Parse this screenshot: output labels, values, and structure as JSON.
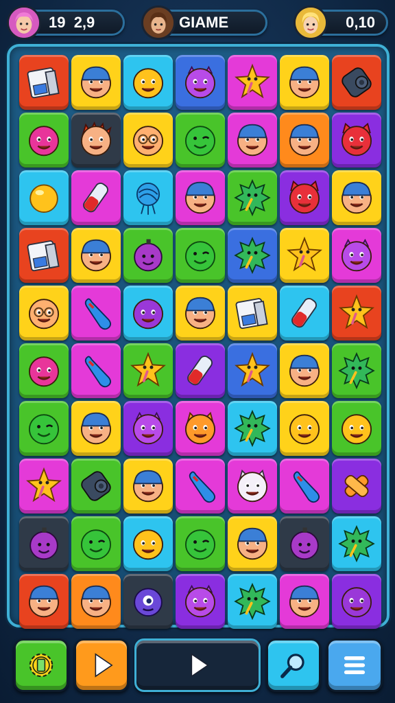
{
  "hud": {
    "left_value": "19  2,9",
    "center_name": "GIAME",
    "right_value": "0,10"
  },
  "colors": {
    "red": "#e8431f",
    "yellow": "#ffd21a",
    "cyan": "#2ec4ef",
    "blue": "#3a6fe0",
    "magenta": "#e43ad8",
    "purple": "#8a2ee0",
    "green": "#49c42a",
    "dark": "#2f3a48",
    "orange": "#ff8a1c"
  },
  "board": {
    "rows": [
      [
        {
          "bg": "red",
          "icon": "floppy-disk-icon"
        },
        {
          "bg": "yellow",
          "icon": "beanie-face-icon"
        },
        {
          "bg": "cyan",
          "icon": "smiley-face-icon"
        },
        {
          "bg": "blue",
          "icon": "purple-devil-icon"
        },
        {
          "bg": "magenta",
          "icon": "star-creature-icon"
        },
        {
          "bg": "yellow",
          "icon": "beanie-face-icon"
        },
        {
          "bg": "red",
          "icon": "film-roll-icon"
        }
      ],
      [
        {
          "bg": "green",
          "icon": "magenta-smiley-icon"
        },
        {
          "bg": "dark",
          "icon": "spiky-hair-face-icon"
        },
        {
          "bg": "yellow",
          "icon": "glasses-face-icon"
        },
        {
          "bg": "green",
          "icon": "green-wink-icon"
        },
        {
          "bg": "magenta",
          "icon": "beanie-face-icon"
        },
        {
          "bg": "orange",
          "icon": "beanie-face-icon"
        },
        {
          "bg": "purple",
          "icon": "red-cat-icon"
        }
      ],
      [
        {
          "bg": "cyan",
          "icon": "yellow-ball-icon"
        },
        {
          "bg": "magenta",
          "icon": "battery-icon"
        },
        {
          "bg": "cyan",
          "icon": "yarn-ball-icon"
        },
        {
          "bg": "magenta",
          "icon": "beanie-face-icon"
        },
        {
          "bg": "green",
          "icon": "spiky-creature-icon"
        },
        {
          "bg": "purple",
          "icon": "red-cat-icon"
        },
        {
          "bg": "yellow",
          "icon": "beanie-face-icon"
        }
      ],
      [
        {
          "bg": "red",
          "icon": "floppy-disk-icon"
        },
        {
          "bg": "yellow",
          "icon": "beanie-face-icon"
        },
        {
          "bg": "green",
          "icon": "bomb-face-icon"
        },
        {
          "bg": "green",
          "icon": "green-wink-icon"
        },
        {
          "bg": "blue",
          "icon": "spiky-creature-icon"
        },
        {
          "bg": "yellow",
          "icon": "star-creature-icon"
        },
        {
          "bg": "magenta",
          "icon": "purple-devil-icon"
        }
      ],
      [
        {
          "bg": "yellow",
          "icon": "glasses-face-icon"
        },
        {
          "bg": "magenta",
          "icon": "bowling-pin-icon"
        },
        {
          "bg": "cyan",
          "icon": "purple-ball-icon"
        },
        {
          "bg": "yellow",
          "icon": "beanie-face-icon"
        },
        {
          "bg": "yellow",
          "icon": "floppy-disk-icon"
        },
        {
          "bg": "cyan",
          "icon": "battery-icon"
        },
        {
          "bg": "red",
          "icon": "star-creature-icon"
        }
      ],
      [
        {
          "bg": "green",
          "icon": "magenta-smiley-icon"
        },
        {
          "bg": "magenta",
          "icon": "bowling-pin-icon"
        },
        {
          "bg": "green",
          "icon": "star-creature-icon"
        },
        {
          "bg": "purple",
          "icon": "battery-icon"
        },
        {
          "bg": "blue",
          "icon": "star-creature-icon"
        },
        {
          "bg": "yellow",
          "icon": "beanie-face-icon"
        },
        {
          "bg": "green",
          "icon": "spiky-creature-icon"
        }
      ],
      [
        {
          "bg": "green",
          "icon": "green-wink-icon"
        },
        {
          "bg": "yellow",
          "icon": "beanie-face-icon"
        },
        {
          "bg": "purple",
          "icon": "purple-devil-icon"
        },
        {
          "bg": "magenta",
          "icon": "orange-cat-icon"
        },
        {
          "bg": "cyan",
          "icon": "spiky-creature-icon"
        },
        {
          "bg": "yellow",
          "icon": "smiley-face-icon"
        },
        {
          "bg": "green",
          "icon": "smiley-face-icon"
        }
      ],
      [
        {
          "bg": "magenta",
          "icon": "star-creature-icon"
        },
        {
          "bg": "green",
          "icon": "film-roll-icon"
        },
        {
          "bg": "yellow",
          "icon": "beanie-face-icon"
        },
        {
          "bg": "magenta",
          "icon": "bowling-pin-icon"
        },
        {
          "bg": "magenta",
          "icon": "white-cat-icon"
        },
        {
          "bg": "magenta",
          "icon": "bowling-pin-icon"
        },
        {
          "bg": "purple",
          "icon": "bandage-icon"
        }
      ],
      [
        {
          "bg": "dark",
          "icon": "bomb-face-icon"
        },
        {
          "bg": "green",
          "icon": "green-wink-icon"
        },
        {
          "bg": "cyan",
          "icon": "smiley-face-icon"
        },
        {
          "bg": "green",
          "icon": "green-wink-icon"
        },
        {
          "bg": "yellow",
          "icon": "beanie-face-icon"
        },
        {
          "bg": "dark",
          "icon": "bomb-face-icon"
        },
        {
          "bg": "cyan",
          "icon": "spiky-creature-icon"
        }
      ],
      [
        {
          "bg": "red",
          "icon": "beanie-face-icon"
        },
        {
          "bg": "orange",
          "icon": "beanie-face-icon"
        },
        {
          "bg": "dark",
          "icon": "cyclops-icon"
        },
        {
          "bg": "purple",
          "icon": "purple-devil-icon"
        },
        {
          "bg": "cyan",
          "icon": "spiky-creature-icon"
        },
        {
          "bg": "magenta",
          "icon": "beanie-face-icon"
        },
        {
          "bg": "purple",
          "icon": "purple-ball-icon"
        }
      ]
    ]
  },
  "bottom_bar": [
    {
      "icon": "gear-icon",
      "bg": "#49c42a"
    },
    {
      "icon": "play-icon",
      "bg": "#ff9a1c"
    },
    {
      "icon": "play-icon",
      "bg": "#16263a"
    },
    {
      "icon": "search-icon",
      "bg": "#2ec4ef"
    },
    {
      "icon": "menu-icon",
      "bg": "#4aa8ee"
    }
  ]
}
